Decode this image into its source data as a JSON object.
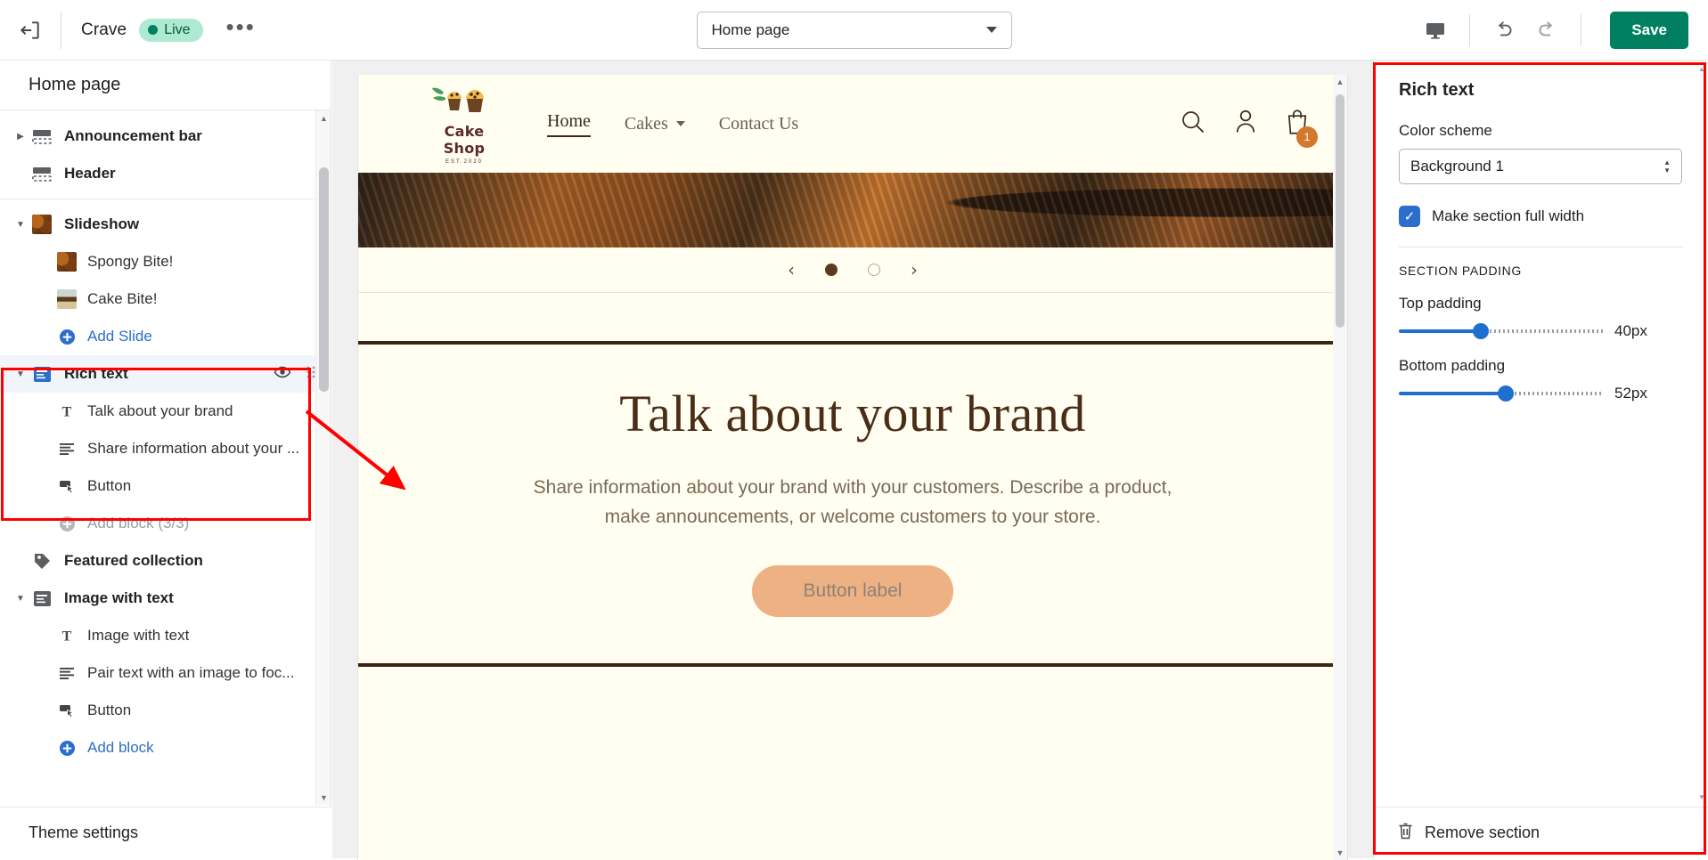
{
  "topbar": {
    "back_icon": "exit-icon",
    "shop_name": "Crave",
    "live_badge": "Live",
    "more_menu": "•••",
    "page_selector": {
      "value": "Home page",
      "icon": "chevron-down-icon"
    },
    "preview_device_icon": "desktop-icon",
    "undo_icon": "undo-icon",
    "redo_icon": "redo-icon",
    "save_label": "Save",
    "save_color": "#008060",
    "live_badge_bg": "#aee9d1"
  },
  "sidebar": {
    "title": "Home page",
    "groups": [
      {
        "items": [
          {
            "label": "Announcement bar",
            "icon": "announcement-bar-icon",
            "expandable": true,
            "expanded": false,
            "level": 0
          },
          {
            "label": "Header",
            "icon": "header-icon",
            "expandable": false,
            "level": 0
          }
        ]
      },
      {
        "items": [
          {
            "label": "Slideshow",
            "icon": "slideshow-thumb-icon",
            "expandable": true,
            "expanded": true,
            "level": 0
          },
          {
            "label": "Spongy Bite!",
            "icon": "slide-thumb-brownie",
            "level": 1
          },
          {
            "label": "Cake Bite!",
            "icon": "slide-thumb-cake",
            "level": 1
          },
          {
            "label": "Add Slide",
            "icon": "plus-circle-icon",
            "level": 1,
            "kind": "add"
          }
        ]
      },
      {
        "selected": true,
        "items": [
          {
            "label": "Rich text",
            "icon": "rich-text-icon",
            "expandable": true,
            "expanded": true,
            "level": 0,
            "selected": true,
            "row_icons": [
              "eye-icon",
              "drag-handle-icon"
            ]
          },
          {
            "label": "Talk about your brand",
            "icon": "heading-text-icon",
            "level": 1
          },
          {
            "label": "Share information about your ...",
            "icon": "paragraph-icon",
            "level": 1
          },
          {
            "label": "Button",
            "icon": "button-icon",
            "level": 1
          },
          {
            "label": "Add block (3/3)",
            "icon": "plus-circle-icon",
            "level": 1,
            "kind": "add-disabled"
          }
        ]
      },
      {
        "items": [
          {
            "label": "Featured collection",
            "icon": "collection-tag-icon",
            "expandable": false,
            "level": 0
          }
        ]
      },
      {
        "items": [
          {
            "label": "Image with text",
            "icon": "image-with-text-icon",
            "expandable": true,
            "expanded": true,
            "level": 0
          },
          {
            "label": "Image with text",
            "icon": "heading-text-icon",
            "level": 1
          },
          {
            "label": "Pair text with an image to foc...",
            "icon": "paragraph-icon",
            "level": 1
          },
          {
            "label": "Button",
            "icon": "button-icon",
            "level": 1
          },
          {
            "label": "Add block",
            "icon": "plus-circle-icon",
            "level": 1,
            "kind": "add"
          }
        ]
      }
    ],
    "footer": {
      "label": "Theme settings",
      "icon": "paint-icon"
    }
  },
  "preview": {
    "store": {
      "logo": {
        "name": "Cake Shop",
        "established": "EST.2020"
      },
      "nav": [
        {
          "label": "Home",
          "active": true,
          "has_dropdown": false
        },
        {
          "label": "Cakes",
          "active": false,
          "has_dropdown": true
        },
        {
          "label": "Contact Us",
          "active": false,
          "has_dropdown": false
        }
      ],
      "actions": {
        "search_icon": "search-icon",
        "account_icon": "account-icon",
        "cart_icon": "cart-icon",
        "cart_count": "1",
        "cart_badge_color": "#d2792e"
      }
    },
    "slideshow": {
      "prev_icon": "chevron-left-icon",
      "next_icon": "chevron-right-icon",
      "dots": [
        {
          "active": true
        },
        {
          "active": false
        }
      ]
    },
    "rich_text": {
      "heading": "Talk about your brand",
      "body": "Share information about your brand with your customers. Describe a product, make announcements, or welcome customers to your store.",
      "button_label": "Button label",
      "button_color": "#eeb184",
      "background_color": "#fffef0",
      "heading_color": "#4a2d16"
    }
  },
  "right_panel": {
    "title": "Rich text",
    "color_scheme": {
      "label": "Color scheme",
      "value": "Background 1"
    },
    "full_width": {
      "label": "Make section full width",
      "checked": true,
      "accent": "#2c6ecb"
    },
    "section_padding_heading": "SECTION PADDING",
    "sliders": [
      {
        "label": "Top padding",
        "value": "40px",
        "percent": 40
      },
      {
        "label": "Bottom padding",
        "value": "52px",
        "percent": 52
      }
    ],
    "footer": {
      "label": "Remove section",
      "icon": "trash-icon"
    }
  },
  "annotations": {
    "color": "#ff0000",
    "highlight_sidebar_section": "Rich text",
    "highlight_right_panel": "Rich text settings",
    "arrow": "points from sidebar Rich text to preview section"
  }
}
